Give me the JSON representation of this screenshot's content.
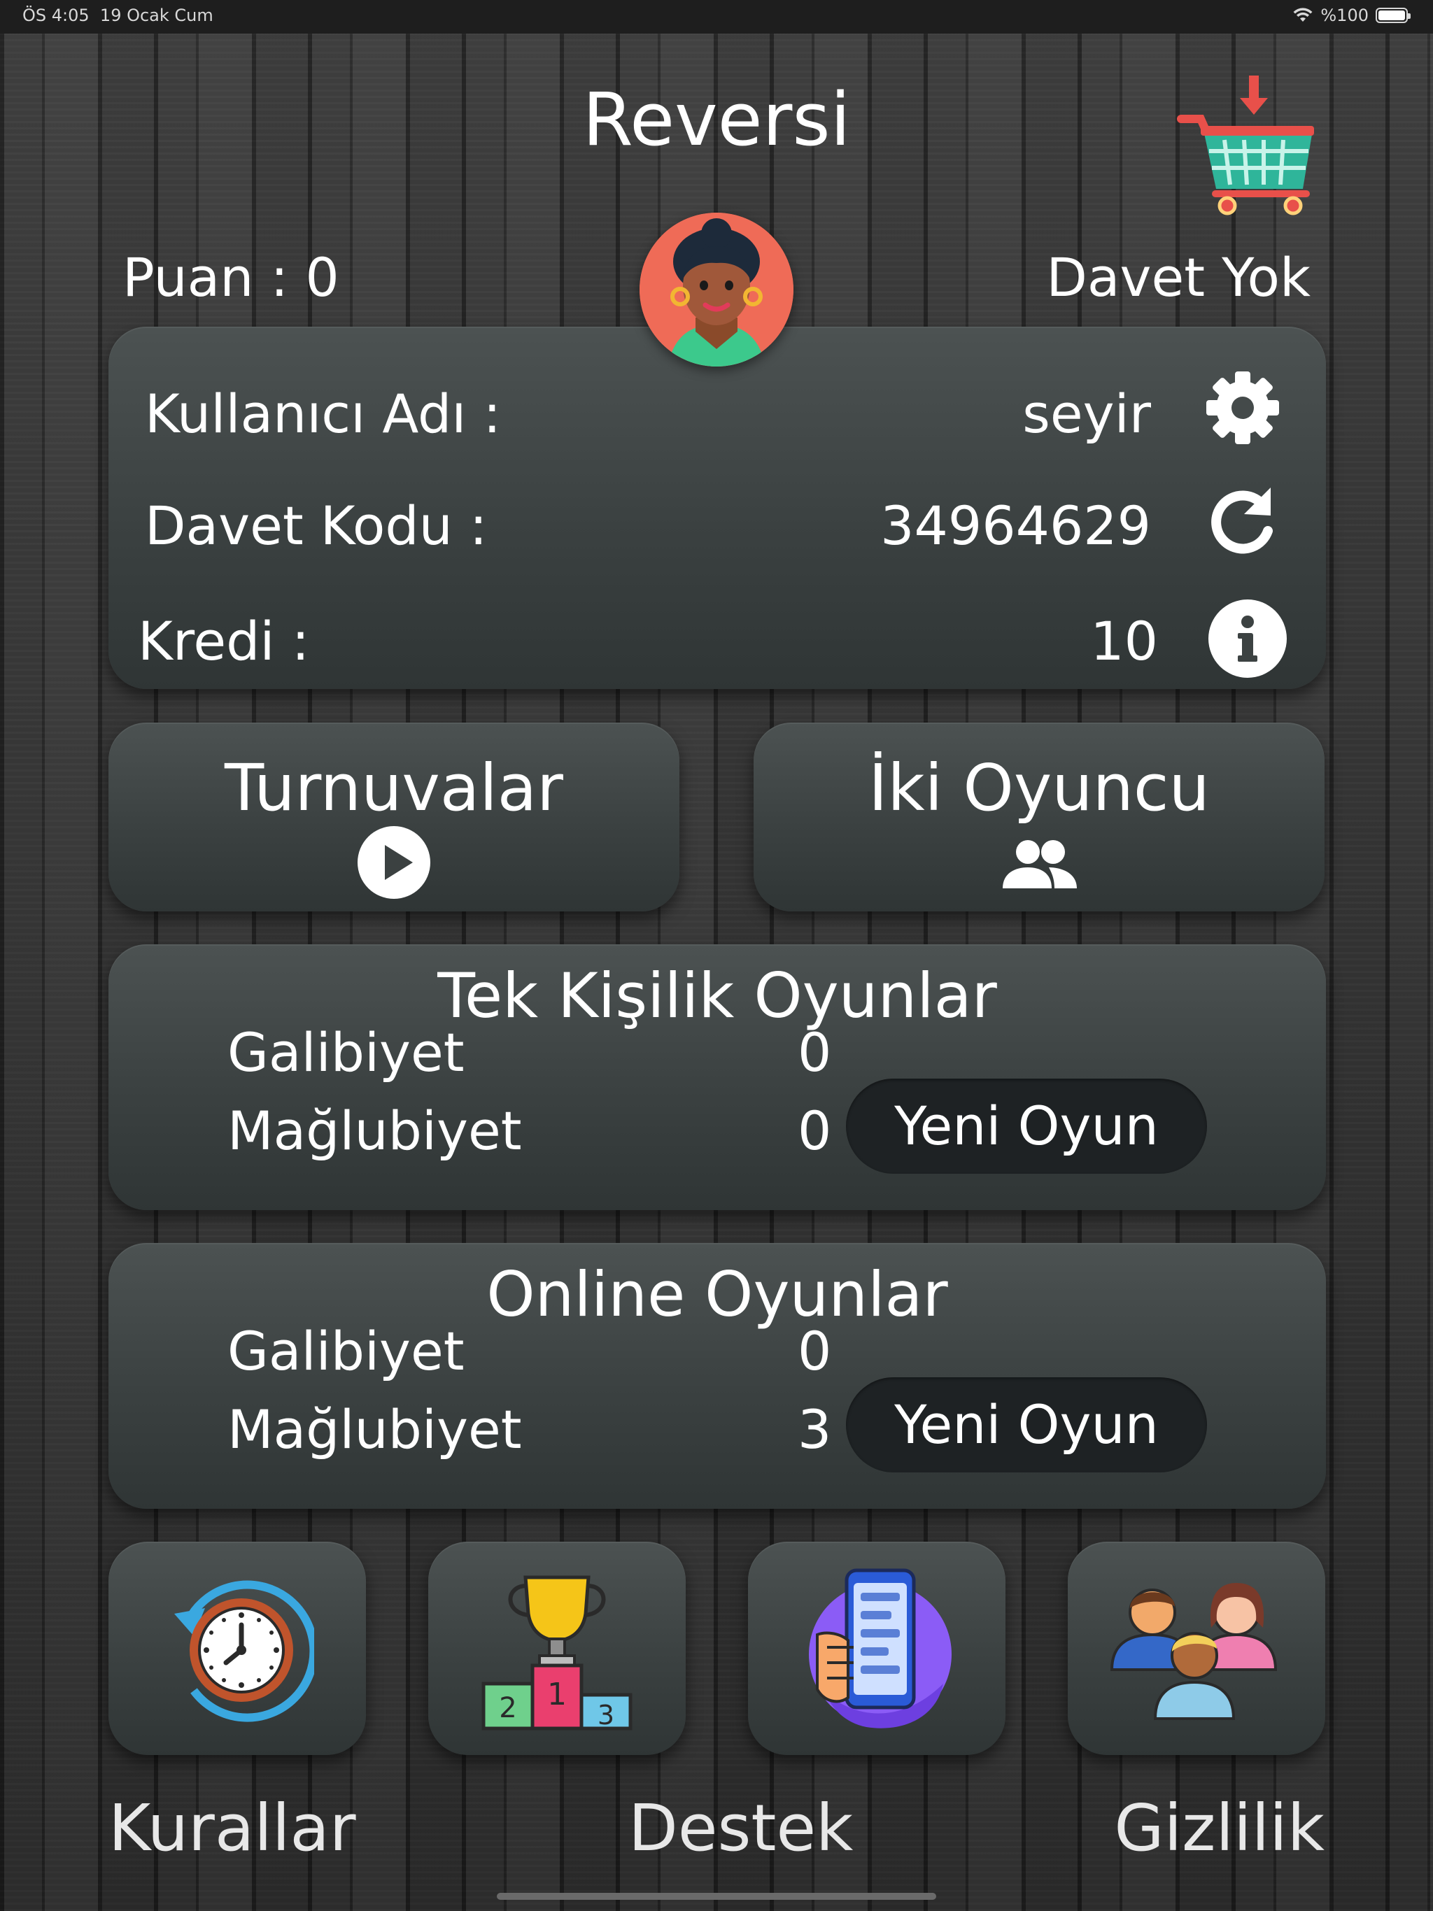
{
  "status_bar": {
    "time": "ÖS 4:05",
    "date": "19 Ocak Cum",
    "battery": "%100"
  },
  "header": {
    "title": "Reversi",
    "score": "Puan : 0",
    "invite_status": "Davet Yok"
  },
  "profile": {
    "username_label": "Kullanıcı Adı :",
    "username_value": "seyir",
    "invite_code_label": "Davet Kodu :",
    "invite_code_value": "34964629",
    "credit_label": "Kredi :",
    "credit_value": "10"
  },
  "modes": {
    "tournaments": "Turnuvalar",
    "two_player": "İki Oyuncu"
  },
  "single_player": {
    "title": "Tek Kişilik Oyunlar",
    "wins_label": "Galibiyet",
    "wins": "0",
    "losses_label": "Mağlubiyet",
    "losses": "0",
    "new_game": "Yeni Oyun"
  },
  "online": {
    "title": "Online Oyunlar",
    "wins_label": "Galibiyet",
    "wins": "0",
    "losses_label": "Mağlubiyet",
    "losses": "3",
    "new_game": "Yeni Oyun"
  },
  "bottom": {
    "rules": "Kurallar",
    "support": "Destek",
    "privacy": "Gizlilik"
  },
  "icons": [
    "cart-icon",
    "avatar",
    "gear-icon",
    "refresh-icon",
    "info-icon",
    "play-icon",
    "group-icon",
    "clock-history-icon",
    "trophy-podium-icon",
    "phone-support-icon",
    "people-icon"
  ],
  "colors": {
    "panel": "#3f4545",
    "pill": "#1e2224",
    "avatar_bg": "#ef6b57"
  }
}
